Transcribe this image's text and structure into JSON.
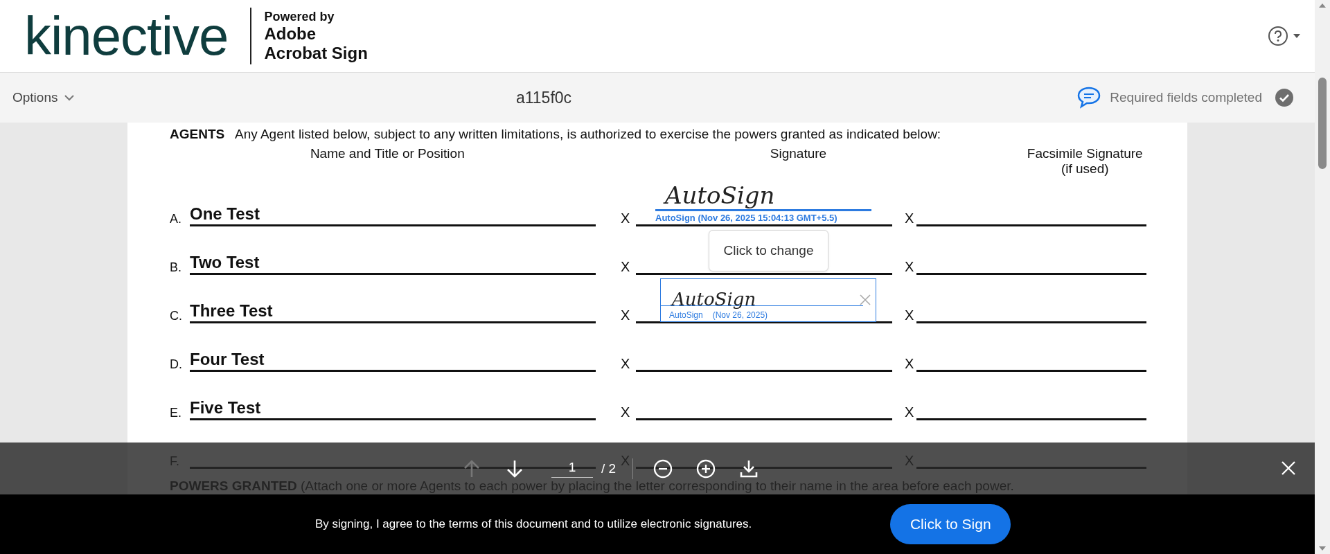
{
  "header": {
    "logo": "kinective",
    "powered_by": [
      "Powered by",
      "Adobe",
      "Acrobat Sign"
    ]
  },
  "toolbar": {
    "options": "Options",
    "document_id": "a115f0c",
    "status": "Required fields completed",
    "completed": true
  },
  "document": {
    "intro_heading": "AGENTS",
    "intro": "Any Agent listed below, subject to any written limitations, is authorized to exercise the powers granted as indicated below:",
    "columns": [
      {
        "lines": [
          "Name and Title or Position"
        ]
      },
      {
        "lines": [
          "Signature"
        ]
      },
      {
        "lines": [
          "Facsimile Signature",
          "(if used)"
        ]
      }
    ],
    "rows": [
      {
        "letter": "A.",
        "name": "One Test",
        "sig_mark": "X",
        "facsimile_mark": "X",
        "signature": {
          "kind": "signed",
          "script": "AutoSign",
          "caption": "AutoSign (Nov 26, 2025 15:04:13 GMT+5.5)"
        }
      },
      {
        "letter": "B.",
        "name": "Two Test",
        "sig_mark": "X",
        "facsimile_mark": "X"
      },
      {
        "letter": "C.",
        "name": "Three Test",
        "sig_mark": "X",
        "facsimile_mark": "X",
        "signature": {
          "kind": "field",
          "script": "AutoSign",
          "caption_name": "AutoSign",
          "caption_date": "(Nov 26, 2025)",
          "tooltip": "Click to change"
        }
      },
      {
        "letter": "D.",
        "name": "Four Test",
        "sig_mark": "X",
        "facsimile_mark": "X"
      },
      {
        "letter": "E.",
        "name": "Five Test",
        "sig_mark": "X",
        "facsimile_mark": "X"
      },
      {
        "letter": "F.",
        "sig_mark": "X",
        "facsimile_mark": "X"
      }
    ],
    "powers_heading": "POWERS GRANTED",
    "powers_text": "(Attach one or more Agents to each power by placing the letter corresponding to their name in the area before each power."
  },
  "pager": {
    "prev_disabled": true,
    "page": "1",
    "total": "/ 2"
  },
  "sign_bar": {
    "notice": "By signing, I agree to the terms of this document and to utilize electronic signatures.",
    "button": "Click to Sign"
  }
}
